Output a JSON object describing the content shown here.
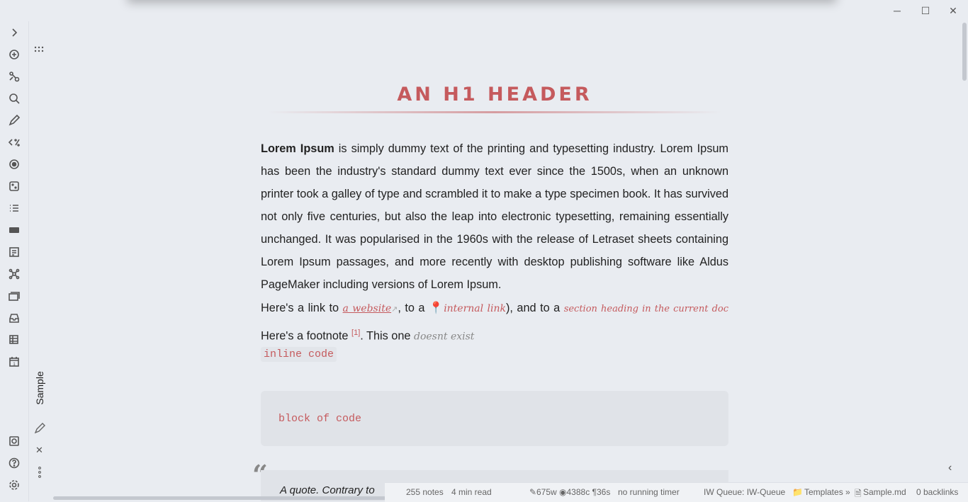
{
  "window_controls": {
    "minimize": "─",
    "maximize": "☐",
    "close": "✕"
  },
  "ribbon": {
    "expand": "›",
    "icons": [
      "plus-circle-icon",
      "graph-icon",
      "search-icon",
      "pencil-icon",
      "templater-icon",
      "target-icon",
      "dice-icon",
      "list-icon",
      "markdown-icon",
      "form-icon",
      "network-icon",
      "cards-icon",
      "inbox-icon",
      "table-icon",
      "calendar-icon",
      "vault-icon",
      "help-icon",
      "settings-icon"
    ],
    "calendar_day": "1"
  },
  "side_tab": {
    "label": "Sample"
  },
  "document": {
    "h1": "AN H1 HEADER",
    "para1_bold": "Lorem Ipsum",
    "para1_rest": " is simply dummy text of the printing and typesetting industry. Lorem Ipsum has been the industry's standard dummy text ever since the 1500s, when an unknown printer took a galley of type and scrambled it to make a type specimen book. It has survived not only five centuries, but also the leap into electronic typesetting, remaining essentially unchanged. It was popularised in the 1960s with the release of Letraset sheets containing Lorem Ipsum passages, and more recently with desktop publishing software like Aldus PageMaker including versions of Lorem Ipsum.",
    "links_prefix": "Here's a link to ",
    "external_link": "a website",
    "to_a": ", to a ",
    "internal_link": "internal link",
    "and_to_a": "), and to a ",
    "section_link": "section heading in the current doc",
    "footnote_prefix": " Here's a footnote ",
    "footnote_ref": "[1]",
    "this_one": ". This one ",
    "unresolved": "doesnt exist",
    "inline_code": "inline code",
    "code_block": "block of code",
    "quote_start": "A quote. Contrary to"
  },
  "status": {
    "notes": "255 notes",
    "read_time": "4 min read",
    "counts": "675w ◉4388c ¶36s",
    "timer": "no running timer",
    "queue": "IW Queue: IW-Queue",
    "path_folder": "Templates »",
    "path_file": "Sample.md",
    "backlinks": "0 backlinks"
  }
}
